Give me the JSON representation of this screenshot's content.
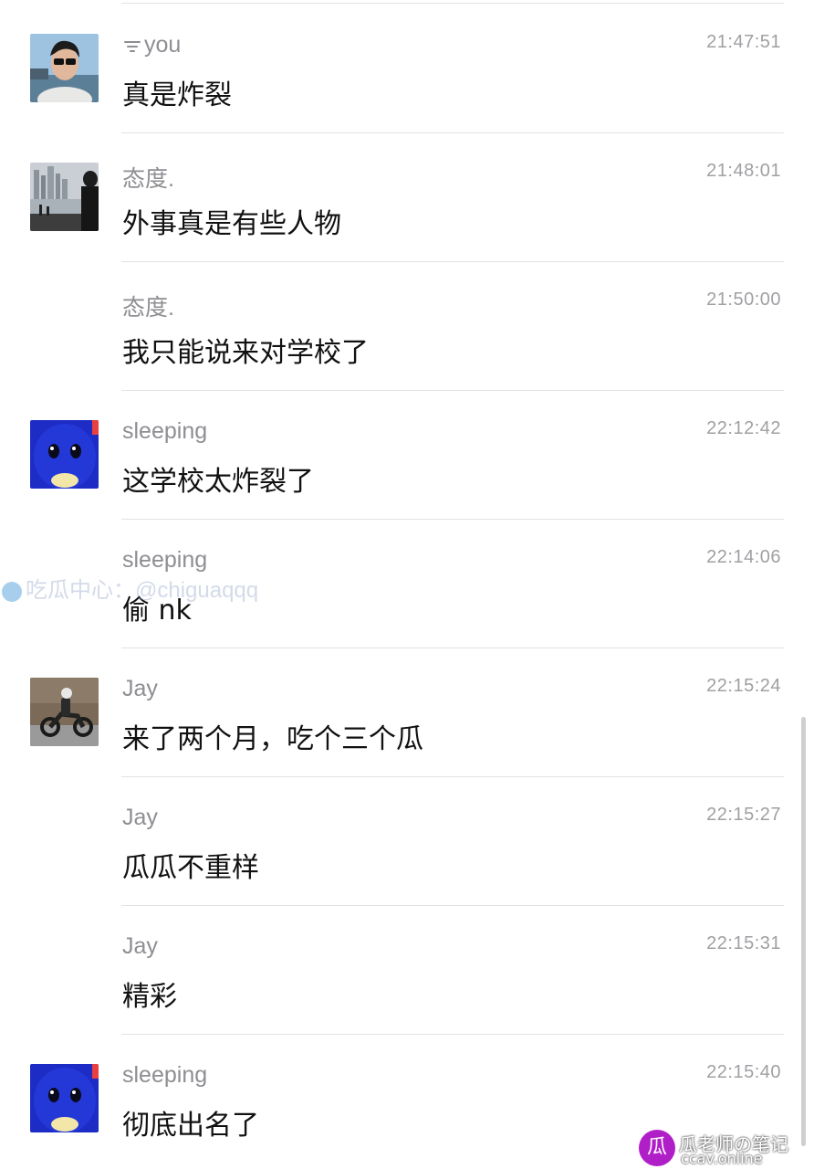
{
  "messages": [
    {
      "name": "you",
      "time": "21:47:51",
      "text": "真是炸裂",
      "avatar": "man-sunglasses"
    },
    {
      "name": "态度.",
      "time": "21:48:01",
      "text": "外事真是有些人物",
      "avatar": "city-waterfront"
    },
    {
      "name": "态度.",
      "time": "21:50:00",
      "text": "我只能说来对学校了",
      "avatar": null
    },
    {
      "name": "sleeping",
      "time": "22:12:42",
      "text": "这学校太炸裂了",
      "avatar": "blue-penguin"
    },
    {
      "name": "sleeping",
      "time": "22:14:06",
      "text": "偷 nk",
      "avatar": null
    },
    {
      "name": "Jay",
      "time": "22:15:24",
      "text": "来了两个月，吃个三个瓜",
      "avatar": "motorcycle-rider"
    },
    {
      "name": "Jay",
      "time": "22:15:27",
      "text": "瓜瓜不重样",
      "avatar": null
    },
    {
      "name": "Jay",
      "time": "22:15:31",
      "text": "精彩",
      "avatar": null
    },
    {
      "name": "sleeping",
      "time": "22:15:40",
      "text": "彻底出名了",
      "avatar": "blue-penguin"
    }
  ],
  "watermark": {
    "text": "吃瓜中心：@chiguaqqq",
    "icon": "telegram-icon"
  },
  "brand": {
    "logo": "瓜",
    "title": "瓜老师の笔记",
    "url": "ccav.online"
  },
  "colors": {
    "name": "#8e8e93",
    "time": "#a0a0a4",
    "text": "#111111",
    "divider": "#e2e2e2",
    "brand": "#b01ec8"
  }
}
